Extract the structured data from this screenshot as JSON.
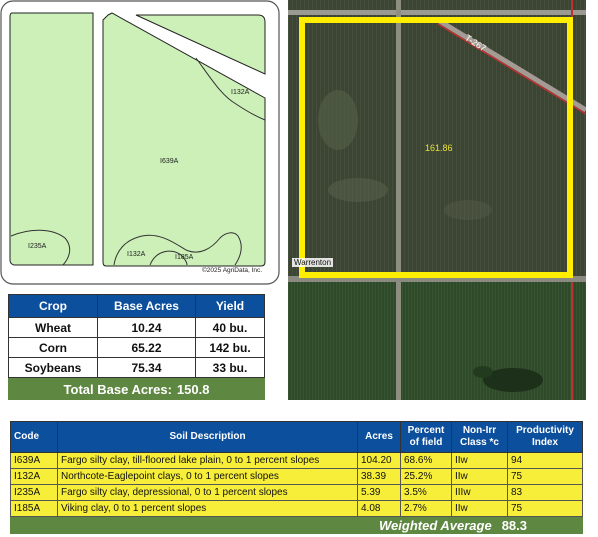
{
  "soil_map": {
    "labels": [
      "I132A",
      "I639A",
      "I235A",
      "I132A",
      "I185A"
    ],
    "copyright": "©2025 AgriData, Inc."
  },
  "aerial": {
    "acres_label": "161.86",
    "place_label": "Warrenton",
    "road_label": "T-267"
  },
  "crop_table": {
    "headers": [
      "Crop",
      "Base Acres",
      "Yield"
    ],
    "rows": [
      {
        "crop": "Wheat",
        "base_acres": "10.24",
        "yield": "40 bu."
      },
      {
        "crop": "Corn",
        "base_acres": "65.22",
        "yield": "142 bu."
      },
      {
        "crop": "Soybeans",
        "base_acres": "75.34",
        "yield": "33 bu."
      }
    ],
    "total_label": "Total Base Acres:",
    "total_value": "150.8"
  },
  "soil_table": {
    "headers": {
      "code": "Code",
      "description": "Soil Description",
      "acres": "Acres",
      "percent_line1": "Percent",
      "percent_line2": "of field",
      "class_line1": "Non-Irr",
      "class_line2": "Class *c",
      "index_line1": "Productivity",
      "index_line2": "Index"
    },
    "rows": [
      {
        "code": "I639A",
        "description": "Fargo silty clay, till-floored lake plain, 0 to 1 percent slopes",
        "acres": "104.20",
        "percent": "68.6%",
        "class": "IIw",
        "index": "94"
      },
      {
        "code": "I132A",
        "description": "Northcote-Eaglepoint clays, 0 to 1 percent slopes",
        "acres": "38.39",
        "percent": "25.2%",
        "class": "IIw",
        "index": "75"
      },
      {
        "code": "I235A",
        "description": "Fargo silty clay, depressional, 0 to 1 percent slopes",
        "acres": "5.39",
        "percent": "3.5%",
        "class": "IIIw",
        "index": "83"
      },
      {
        "code": "I185A",
        "description": "Viking clay, 0 to 1 percent slopes",
        "acres": "4.08",
        "percent": "2.7%",
        "class": "IIw",
        "index": "75"
      }
    ],
    "avg_label": "Weighted Average",
    "avg_value": "88.3"
  },
  "colors": {
    "header_blue": "#0c4f9c",
    "total_green": "#5e8741",
    "row_yellow": "#f7ee3a",
    "soil_green": "#ccf0b8",
    "boundary_yellow": "#ffee00"
  }
}
